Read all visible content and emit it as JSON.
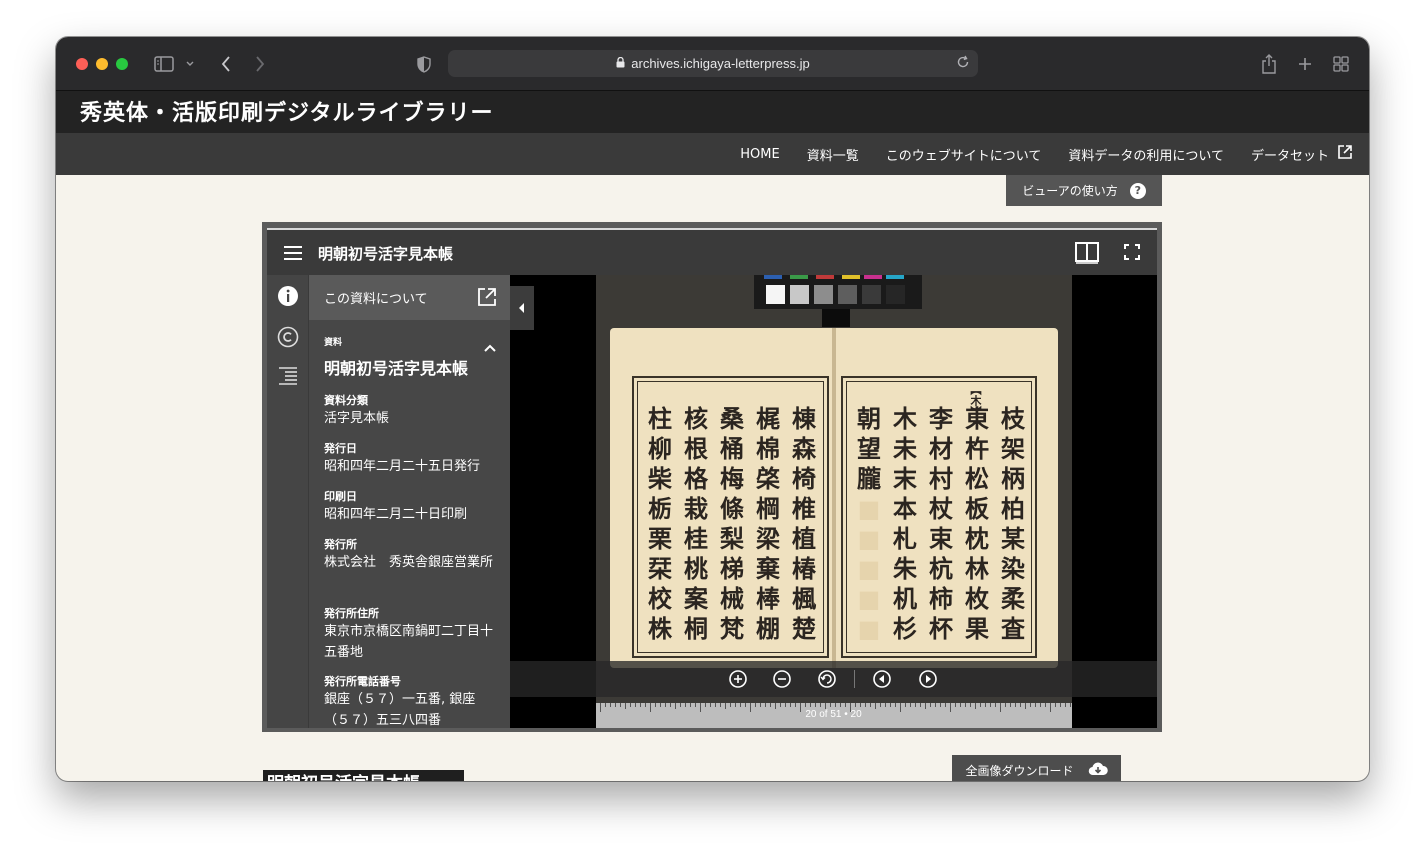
{
  "browser": {
    "url": "archives.ichigaya-letterpress.jp"
  },
  "site": {
    "title": "秀英体・活版印刷デジタルライブラリー",
    "nav": [
      "HOME",
      "資料一覧",
      "このウェブサイトについて",
      "資料データの利用について",
      "データセット"
    ],
    "help_label": "ビューアの使い方",
    "download_label": "全画像ダウンロード",
    "below_title": "明朝初号活字見本帳"
  },
  "viewer": {
    "title": "明朝初号活字見本帳",
    "page_label": "20 of 51 • 20",
    "panel": {
      "header": "この資料について",
      "category": "資料",
      "name": "明朝初号活字見本帳",
      "fields": [
        {
          "label": "資料分類",
          "value": "活字見本帳"
        },
        {
          "label": "発行日",
          "value": "昭和四年二月二十五日発行"
        },
        {
          "label": "印刷日",
          "value": "昭和四年二月二十日印刷"
        },
        {
          "label": "発行所",
          "value": "株式会社　秀英舎銀座営業所"
        },
        {
          "label": "発行所住所",
          "value": "東京市京橋区南鍋町二丁目十五番地"
        },
        {
          "label": "発行所電話番号",
          "value": "銀座（５７）一五番, 銀座（５７）五三八四番"
        }
      ]
    },
    "left_page": [
      "棟",
      "梶",
      "桑",
      "核",
      "柱",
      "森",
      "棉",
      "桶",
      "根",
      "柳",
      "椅",
      "棨",
      "梅",
      "格",
      "柴",
      "椎",
      "棡",
      "條",
      "栽",
      "栃",
      "植",
      "梁",
      "梨",
      "桂",
      "栗",
      "椿",
      "棄",
      "梯",
      "桃",
      "栞",
      "楓",
      "棒",
      "械",
      "案",
      "校",
      "楚",
      "棚",
      "梵",
      "桐",
      "株"
    ],
    "right_page": [
      "枝",
      "東",
      "李",
      "木",
      "朝",
      "架",
      "杵",
      "材",
      "未",
      "望",
      "柄",
      "松",
      "村",
      "末",
      "朧",
      "柏",
      "板",
      "杖",
      "本",
      "",
      "某",
      "枕",
      "束",
      "札",
      "",
      "染",
      "林",
      "杭",
      "朱",
      "",
      "柔",
      "枚",
      "柿",
      "机",
      "",
      "査",
      "果",
      "杯",
      "杉",
      ""
    ],
    "right_marker": "【木】",
    "colors": {
      "chrome": "#2a2a2c",
      "page_bg": "#f6f3ec",
      "viewer_header": "#3a3a3a",
      "paper": "#efe1c0"
    }
  }
}
